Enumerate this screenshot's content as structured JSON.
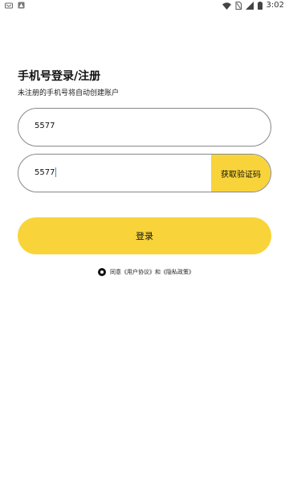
{
  "status_bar": {
    "time": "3:02",
    "icons": [
      "notification-icon",
      "warning-icon",
      "wifi-icon",
      "no-sim-icon",
      "signal-icon",
      "battery-icon"
    ]
  },
  "login": {
    "title": "手机号登录/注册",
    "subtitle": "未注册的手机号将自动创建账户",
    "phone_value": "5577",
    "code_value": "5577",
    "get_code_label": "获取验证码",
    "login_label": "登录",
    "agreement_text": "同意《用户协议》和《隐私政策》"
  },
  "colors": {
    "accent": "#f8d43a",
    "border": "#888888",
    "cursor": "#2aa0b0"
  }
}
